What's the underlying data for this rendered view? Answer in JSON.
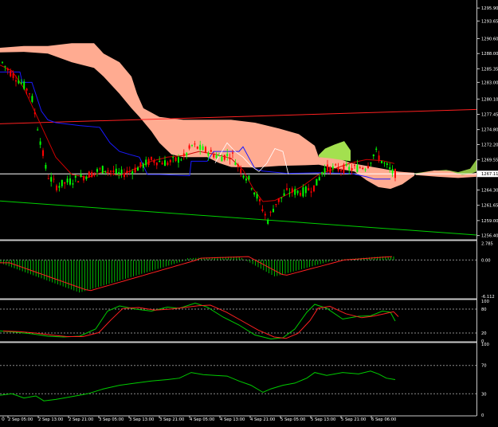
{
  "chart_data": [
    {
      "type": "candlestick",
      "panel": "main",
      "price_axis_ticks": [
        "1295.90",
        "1293.65",
        "1290.60",
        "1288.00",
        "1285.35",
        "1283.00",
        "1280.10",
        "1277.45",
        "1274.80",
        "1272.20",
        "1269.55",
        "1267.11",
        "1264.30",
        "1261.65",
        "1259.00",
        "1256.40"
      ],
      "current_price": "1267.11",
      "ylim": [
        1255.8,
        1297.3
      ],
      "overlays": [
        "ichimoku-cloud",
        "tenkan-kijun",
        "trendline-upper",
        "trendline-lower",
        "current-price-line"
      ],
      "colors": {
        "bull": "#00ff00",
        "bear": "#ff0000",
        "cloud_bear": "#ffab91",
        "cloud_bull": "#a3e04f",
        "trend_upper": "#ff2020",
        "trend_lower": "#00d000",
        "kijun": "#1a1aff",
        "tenkan": "#cc0000",
        "chikou": "#ffffff",
        "price_line": "#ffffff"
      }
    },
    {
      "type": "histogram",
      "panel": "oscillator",
      "ticks": [
        "2.785",
        "0.00",
        "-6.112"
      ],
      "ylim": [
        -6.4,
        3.0
      ],
      "colors": {
        "bars": "#00cc00",
        "signal": "#ff2020"
      }
    },
    {
      "type": "line",
      "panel": "stochastic",
      "ticks": [
        "100",
        "80",
        "20",
        "0"
      ],
      "ylim": [
        0,
        100
      ],
      "levels": [
        80,
        20
      ],
      "colors": {
        "main": "#00cc00",
        "signal": "#ff2020"
      }
    },
    {
      "type": "line",
      "panel": "rsi",
      "ticks": [
        "100",
        "70",
        "30",
        "0"
      ],
      "ylim": [
        0,
        100
      ],
      "levels": [
        70,
        30
      ],
      "colors": {
        "main": "#00cc00"
      }
    }
  ],
  "time_axis": [
    "2 Sep 05:00",
    "2 Sep 13:00",
    "2 Sep 21:00",
    "3 Sep 05:00",
    "3 Sep 13:00",
    "3 Sep 21:00",
    "4 Sep 05:00",
    "4 Sep 13:00",
    "4 Sep 21:00",
    "5 Sep 05:00",
    "5 Sep 13:00",
    "5 Sep 21:00",
    "6 Sep 06:00"
  ],
  "x_first_label": "0"
}
